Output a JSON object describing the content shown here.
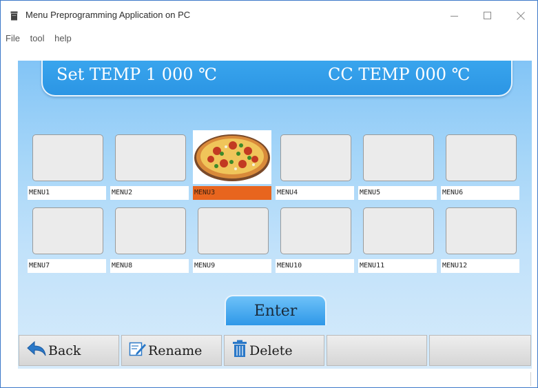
{
  "window": {
    "title": "Menu Preprogramming Application on PC",
    "controls": [
      "minimize",
      "maximize",
      "close"
    ]
  },
  "menubar": {
    "items": [
      "File",
      "tool",
      "help"
    ]
  },
  "temperature": {
    "set_temp": "Set TEMP 1 000 ℃",
    "cc_temp": "CC TEMP 000 ℃"
  },
  "menus": [
    {
      "label": "MENU1"
    },
    {
      "label": "MENU2"
    },
    {
      "label": "MENU3",
      "selected": true,
      "image": "pizza"
    },
    {
      "label": "MENU4"
    },
    {
      "label": "MENU5"
    },
    {
      "label": "MENU6"
    },
    {
      "label": "MENU7"
    },
    {
      "label": "MENU8"
    },
    {
      "label": "MENU9"
    },
    {
      "label": "MENU10"
    },
    {
      "label": "MENU11"
    },
    {
      "label": "MENU12"
    }
  ],
  "enter_label": "Enter",
  "bottom_buttons": [
    {
      "label": "Back",
      "icon": "back-arrow-icon"
    },
    {
      "label": "Rename",
      "icon": "edit-icon"
    },
    {
      "label": "Delete",
      "icon": "trash-icon"
    },
    {
      "label": "",
      "icon": ""
    },
    {
      "label": "",
      "icon": ""
    }
  ],
  "colors": {
    "panel_blue": "#82c4f6",
    "banner_blue": "#2b95e4",
    "selected_orange": "#e8651e",
    "tile_gray": "#ebebeb"
  }
}
